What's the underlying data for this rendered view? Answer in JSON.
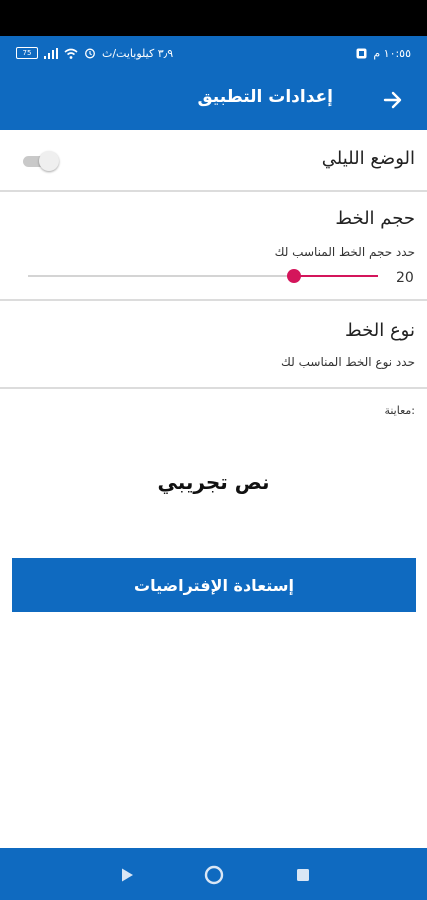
{
  "status_bar": {
    "time": "١٠:٥٥ م",
    "carrier": "٣٫٩ كيلوبايت/ث",
    "battery": "75"
  },
  "header": {
    "title": "إعدادات التطبيق",
    "back_icon": "arrow-right-icon"
  },
  "night_mode": {
    "label": "الوضع الليلي",
    "enabled": false
  },
  "font_size": {
    "title": "حجم الخط",
    "subtitle": "حدد حجم الخط المناسب لك",
    "value": "20",
    "slider_fraction": 0.24
  },
  "font_type": {
    "title": "نوع الخط",
    "subtitle": "حدد نوع الخط المناسب لك"
  },
  "preview": {
    "label": "معاينة:",
    "sample_text": "نص تجريبي"
  },
  "reset_button": {
    "label": "إستعادة الإفتراضيات"
  },
  "nav_bar": {
    "back_icon": "triangle-back-icon",
    "home_icon": "circle-home-icon",
    "recents_icon": "square-recents-icon"
  },
  "colors": {
    "primary": "#0f6ac0",
    "accent": "#d4155b"
  }
}
